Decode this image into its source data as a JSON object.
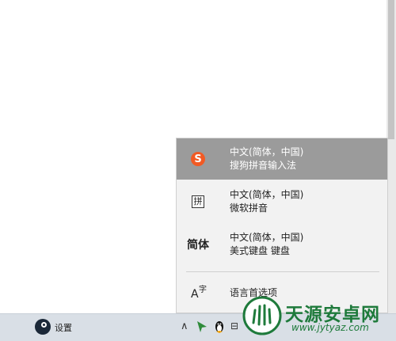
{
  "ime_menu": {
    "items": [
      {
        "line1": "中文(简体，中国)",
        "line2": "搜狗拼音输入法",
        "icon": "sogou-icon",
        "icon_text": "S",
        "selected": true
      },
      {
        "line1": "中文(简体，中国)",
        "line2": "微软拼音",
        "icon": "pinyin-icon",
        "icon_text": "拼",
        "selected": false
      },
      {
        "line1": "中文(简体，中国)",
        "line2": "美式键盘 键盘",
        "icon": "jianti-icon",
        "icon_text": "简体",
        "selected": false
      }
    ],
    "language_pref": {
      "label": "语言首选项",
      "icon_big": "A",
      "icon_small": "字"
    }
  },
  "taskbar": {
    "settings_label": "设置",
    "tray_chevron": "∧",
    "network_glyph": "⊟"
  },
  "watermark": {
    "title": "天源安卓网",
    "url": "www.jytyaz.com"
  },
  "colors": {
    "selected_bg": "#9b9b9b",
    "menu_bg": "#f2f2f2",
    "taskbar_bg": "#d9dfe6",
    "sogou_orange": "#f15a24",
    "watermark_green": "#1e7a3b"
  }
}
